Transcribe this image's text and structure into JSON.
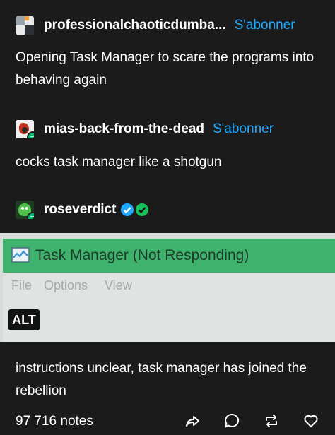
{
  "posts": [
    {
      "username": "professionalchaoticdumba...",
      "follow_label": "S'abonner",
      "text": "Opening Task Manager to scare the programs into behaving again"
    },
    {
      "username": "mias-back-from-the-dead",
      "follow_label": "S'abonner",
      "text": "cocks task manager like a shotgun"
    },
    {
      "username": "roseverdict",
      "text": "instructions unclear, task manager has joined the rebellion"
    }
  ],
  "image": {
    "window_title": "Task Manager (Not Responding)",
    "menu": [
      "File",
      "Options",
      "View"
    ],
    "alt_badge": "ALT"
  },
  "footer": {
    "notes": "97 716 notes"
  },
  "icons": [
    "reblog-icon",
    "verified-icon",
    "share-icon",
    "reply-icon",
    "reblog-icon",
    "like-icon"
  ],
  "colors": {
    "accent": "#1fa9ff",
    "reblog_green": "#00b86b",
    "background": "#1b1b1b"
  }
}
